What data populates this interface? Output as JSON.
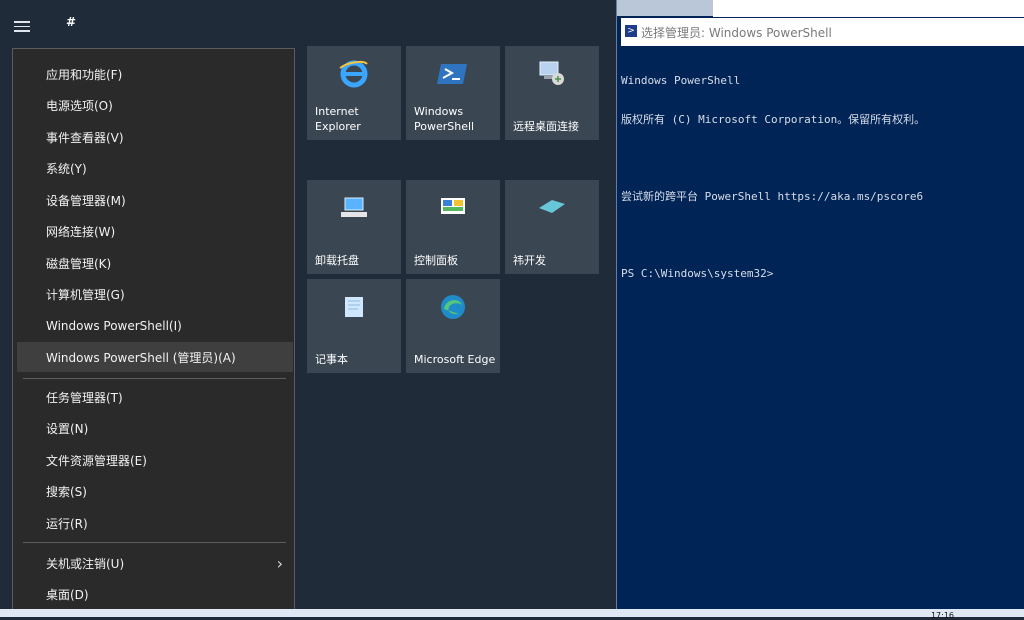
{
  "start": {
    "hash_label": "#"
  },
  "winx_menu": {
    "items": [
      {
        "label": "应用和功能(F)"
      },
      {
        "label": "电源选项(O)"
      },
      {
        "label": "事件查看器(V)"
      },
      {
        "label": "系统(Y)"
      },
      {
        "label": "设备管理器(M)"
      },
      {
        "label": "网络连接(W)"
      },
      {
        "label": "磁盘管理(K)"
      },
      {
        "label": "计算机管理(G)"
      },
      {
        "label": "Windows PowerShell(I)"
      },
      {
        "label": "Windows PowerShell (管理员)(A)"
      },
      {
        "label": "任务管理器(T)"
      },
      {
        "label": "设置(N)"
      },
      {
        "label": "文件资源管理器(E)"
      },
      {
        "label": "搜索(S)"
      },
      {
        "label": "运行(R)"
      },
      {
        "label": "关机或注销(U)"
      },
      {
        "label": "桌面(D)"
      }
    ]
  },
  "tiles": {
    "ie": {
      "line1": "Internet",
      "line2": "Explorer",
      "icon": "internet-explorer-icon"
    },
    "powershell": {
      "line1": "Windows",
      "line2": "PowerShell",
      "icon": "powershell-icon"
    },
    "rdp": {
      "label": "远程桌面连接",
      "icon": "remote-desktop-icon"
    },
    "uninstall": {
      "label": "卸载托盘",
      "icon": "uninstall-icon"
    },
    "control": {
      "label": "控制面板",
      "icon": "control-panel-icon"
    },
    "weikaifa": {
      "label": "祎开发",
      "icon": "folder-icon"
    },
    "notepad": {
      "label": "记事本",
      "icon": "notepad-icon"
    },
    "edge": {
      "label": "Microsoft Edge",
      "icon": "edge-icon"
    }
  },
  "powershell_window": {
    "title": "选择管理员: Windows PowerShell",
    "lines": [
      "Windows PowerShell",
      "版权所有 (C) Microsoft Corporation。保留所有权利。",
      "",
      "尝试新的跨平台 PowerShell https://aka.ms/pscore6",
      "",
      "PS C:\\Windows\\system32>"
    ]
  },
  "taskbar": {
    "clock": "17:16"
  },
  "colors": {
    "start_bg": "#1f2b38",
    "tile_bg": "#3a4652",
    "menu_bg": "#2a2a2a",
    "ps_bg": "#012456"
  }
}
